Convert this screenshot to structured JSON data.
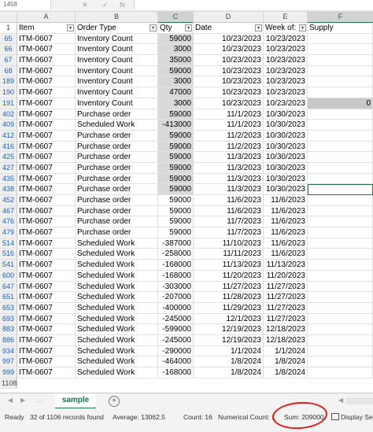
{
  "formula_bar": {
    "name_box": "1458",
    "cancel": "✕",
    "confirm": "✓",
    "fx": "fx"
  },
  "columns": [
    "A",
    "B",
    "C",
    "D",
    "E",
    "F"
  ],
  "header_row": {
    "row_num": "1",
    "cells": [
      "Item",
      "Order Type",
      "Qty",
      "Date",
      "Week of:",
      "Supply"
    ]
  },
  "rows": [
    {
      "n": "65",
      "item": "ITM-0607",
      "type": "Inventory Count",
      "qty": "59000",
      "date": "10/23/2023",
      "week": "10/23/2023",
      "supply": ""
    },
    {
      "n": "66",
      "item": "ITM-0607",
      "type": "Inventory Count",
      "qty": "3000",
      "date": "10/23/2023",
      "week": "10/23/2023",
      "supply": ""
    },
    {
      "n": "67",
      "item": "ITM-0607",
      "type": "Inventory Count",
      "qty": "35000",
      "date": "10/23/2023",
      "week": "10/23/2023",
      "supply": ""
    },
    {
      "n": "68",
      "item": "ITM-0607",
      "type": "Inventory Count",
      "qty": "59000",
      "date": "10/23/2023",
      "week": "10/23/2023",
      "supply": ""
    },
    {
      "n": "189",
      "item": "ITM-0607",
      "type": "Inventory Count",
      "qty": "3000",
      "date": "10/23/2023",
      "week": "10/23/2023",
      "supply": ""
    },
    {
      "n": "190",
      "item": "ITM-0607",
      "type": "Inventory Count",
      "qty": "47000",
      "date": "10/23/2023",
      "week": "10/23/2023",
      "supply": ""
    },
    {
      "n": "191",
      "item": "ITM-0607",
      "type": "Inventory Count",
      "qty": "3000",
      "date": "10/23/2023",
      "week": "10/23/2023",
      "supply": "0"
    },
    {
      "n": "402",
      "item": "ITM-0607",
      "type": "Purchase order",
      "qty": "59000",
      "date": "11/1/2023",
      "week": "10/30/2023",
      "supply": ""
    },
    {
      "n": "409",
      "item": "ITM-0607",
      "type": "Scheduled Work",
      "qty": "-413000",
      "date": "11/1/2023",
      "week": "10/30/2023",
      "supply": ""
    },
    {
      "n": "412",
      "item": "ITM-0607",
      "type": "Purchase order",
      "qty": "59000",
      "date": "11/2/2023",
      "week": "10/30/2023",
      "supply": ""
    },
    {
      "n": "416",
      "item": "ITM-0607",
      "type": "Purchase order",
      "qty": "59000",
      "date": "11/2/2023",
      "week": "10/30/2023",
      "supply": ""
    },
    {
      "n": "425",
      "item": "ITM-0607",
      "type": "Purchase order",
      "qty": "59000",
      "date": "11/3/2023",
      "week": "10/30/2023",
      "supply": ""
    },
    {
      "n": "427",
      "item": "ITM-0607",
      "type": "Purchase order",
      "qty": "59000",
      "date": "11/3/2023",
      "week": "10/30/2023",
      "supply": ""
    },
    {
      "n": "435",
      "item": "ITM-0607",
      "type": "Purchase order",
      "qty": "59000",
      "date": "11/3/2023",
      "week": "10/30/2023",
      "supply": ""
    },
    {
      "n": "438",
      "item": "ITM-0607",
      "type": "Purchase order",
      "qty": "59000",
      "date": "11/3/2023",
      "week": "10/30/2023",
      "supply": ""
    },
    {
      "n": "452",
      "item": "ITM-0607",
      "type": "Purchase order",
      "qty": "59000",
      "date": "11/6/2023",
      "week": "11/6/2023",
      "supply": ""
    },
    {
      "n": "467",
      "item": "ITM-0607",
      "type": "Purchase order",
      "qty": "59000",
      "date": "11/6/2023",
      "week": "11/6/2023",
      "supply": ""
    },
    {
      "n": "476",
      "item": "ITM-0607",
      "type": "Purchase order",
      "qty": "59000",
      "date": "11/7/2023",
      "week": "11/6/2023",
      "supply": ""
    },
    {
      "n": "479",
      "item": "ITM-0607",
      "type": "Purchase order",
      "qty": "59000",
      "date": "11/7/2023",
      "week": "11/6/2023",
      "supply": ""
    },
    {
      "n": "514",
      "item": "ITM-0607",
      "type": "Scheduled Work",
      "qty": "-387000",
      "date": "11/10/2023",
      "week": "11/6/2023",
      "supply": ""
    },
    {
      "n": "516",
      "item": "ITM-0607",
      "type": "Scheduled Work",
      "qty": "-258000",
      "date": "11/11/2023",
      "week": "11/6/2023",
      "supply": ""
    },
    {
      "n": "541",
      "item": "ITM-0607",
      "type": "Scheduled Work",
      "qty": "-168000",
      "date": "11/13/2023",
      "week": "11/13/2023",
      "supply": ""
    },
    {
      "n": "600",
      "item": "ITM-0607",
      "type": "Scheduled Work",
      "qty": "-168000",
      "date": "11/20/2023",
      "week": "11/20/2023",
      "supply": ""
    },
    {
      "n": "647",
      "item": "ITM-0607",
      "type": "Scheduled Work",
      "qty": "-303000",
      "date": "11/27/2023",
      "week": "11/27/2023",
      "supply": ""
    },
    {
      "n": "651",
      "item": "ITM-0607",
      "type": "Scheduled Work",
      "qty": "-207000",
      "date": "11/28/2023",
      "week": "11/27/2023",
      "supply": ""
    },
    {
      "n": "653",
      "item": "ITM-0607",
      "type": "Scheduled Work",
      "qty": "-400000",
      "date": "11/29/2023",
      "week": "11/27/2023",
      "supply": ""
    },
    {
      "n": "693",
      "item": "ITM-0607",
      "type": "Scheduled Work",
      "qty": "-245000",
      "date": "12/1/2023",
      "week": "11/27/2023",
      "supply": ""
    },
    {
      "n": "883",
      "item": "ITM-0607",
      "type": "Scheduled Work",
      "qty": "-599000",
      "date": "12/19/2023",
      "week": "12/18/2023",
      "supply": ""
    },
    {
      "n": "886",
      "item": "ITM-0607",
      "type": "Scheduled Work",
      "qty": "-245000",
      "date": "12/19/2023",
      "week": "12/18/2023",
      "supply": ""
    },
    {
      "n": "934",
      "item": "ITM-0607",
      "type": "Scheduled Work",
      "qty": "-290000",
      "date": "1/1/2024",
      "week": "1/1/2024",
      "supply": ""
    },
    {
      "n": "997",
      "item": "ITM-0607",
      "type": "Scheduled Work",
      "qty": "-464000",
      "date": "1/8/2024",
      "week": "1/8/2024",
      "supply": ""
    },
    {
      "n": "999",
      "item": "ITM-0607",
      "type": "Scheduled Work",
      "qty": "-168000",
      "date": "1/8/2024",
      "week": "1/8/2024",
      "supply": ""
    }
  ],
  "last_row": "1108",
  "sheet_tab": "sample",
  "add_sheet": "+",
  "status": {
    "ready": "Ready",
    "records": "32 of 1106 records found",
    "average": "Average: 13062.5",
    "count": "Count: 16",
    "numerical_count": "Numerical Count: 16",
    "sum": "Sum: 209000",
    "display": "Display Setti"
  },
  "colors": {
    "excel_green": "#217346",
    "annotation_red": "#e31b1b",
    "selection_grey": "#d9d9d9"
  }
}
